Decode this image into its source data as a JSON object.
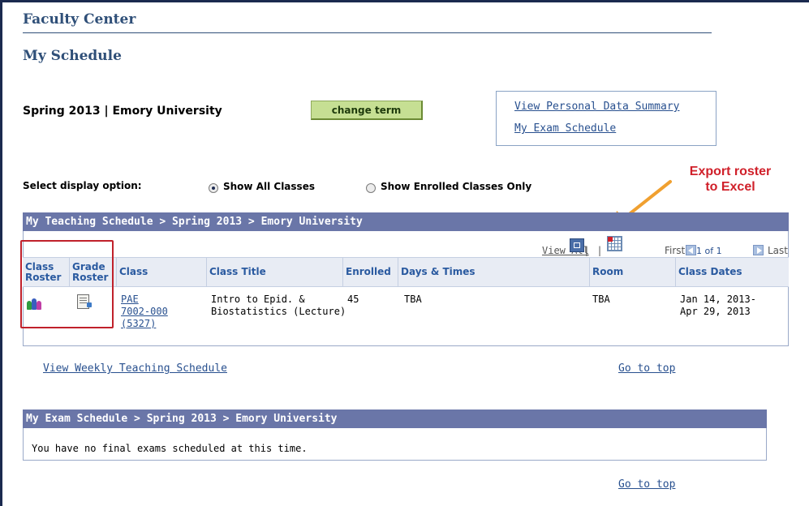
{
  "header": {
    "app_title": "Faculty Center",
    "page_title": "My Schedule"
  },
  "term": {
    "label": "Spring 2013 | Emory University",
    "change_button": "change term"
  },
  "quick_links": [
    {
      "label": "View Personal Data Summary"
    },
    {
      "label": "My Exam Schedule"
    }
  ],
  "display_option": {
    "label": "Select display option:",
    "options": [
      {
        "label": "Show All Classes",
        "selected": true
      },
      {
        "label": "Show Enrolled Classes Only",
        "selected": false
      }
    ]
  },
  "annotation": {
    "text_line1": "Export roster",
    "text_line2": "to Excel",
    "color": "#d0202a"
  },
  "teaching": {
    "section_title": "My Teaching Schedule > Spring 2013 > Emory University",
    "nav": {
      "view_all": "View All",
      "sep": "|",
      "first": "First",
      "count": "1 of 1",
      "last": "Last"
    },
    "columns": {
      "class_roster_l1": "Class",
      "class_roster_l2": "Roster",
      "grade_roster_l1": "Grade",
      "grade_roster_l2": "Roster",
      "class": "Class",
      "class_title": "Class Title",
      "enrolled": "Enrolled",
      "days_times": "Days & Times",
      "room": "Room",
      "class_dates": "Class Dates"
    },
    "rows": [
      {
        "class_line1": "PAE",
        "class_line2": "7002-000",
        "class_line3": "(5327)",
        "title_line1": "Intro to Epid. &",
        "title_line2": "Biostatistics (Lecture)",
        "enrolled": "45",
        "days_times": "TBA",
        "room": "TBA",
        "dates_line1": "Jan 14, 2013-",
        "dates_line2": "Apr 29, 2013"
      }
    ],
    "weekly_link": "View Weekly Teaching Schedule",
    "go_to_top": "Go to top"
  },
  "exam": {
    "section_title": "My Exam Schedule > Spring 2013 > Emory University",
    "message": "You have no final exams scheduled at this time.",
    "go_to_top": "Go to top"
  },
  "colors": {
    "header_blue": "#2f4f78",
    "section_bar": "#6a76a8",
    "link": "#28508f",
    "button_green": "#c6df93",
    "highlight_red": "#c0212b",
    "arrow_orange": "#f0a030"
  }
}
